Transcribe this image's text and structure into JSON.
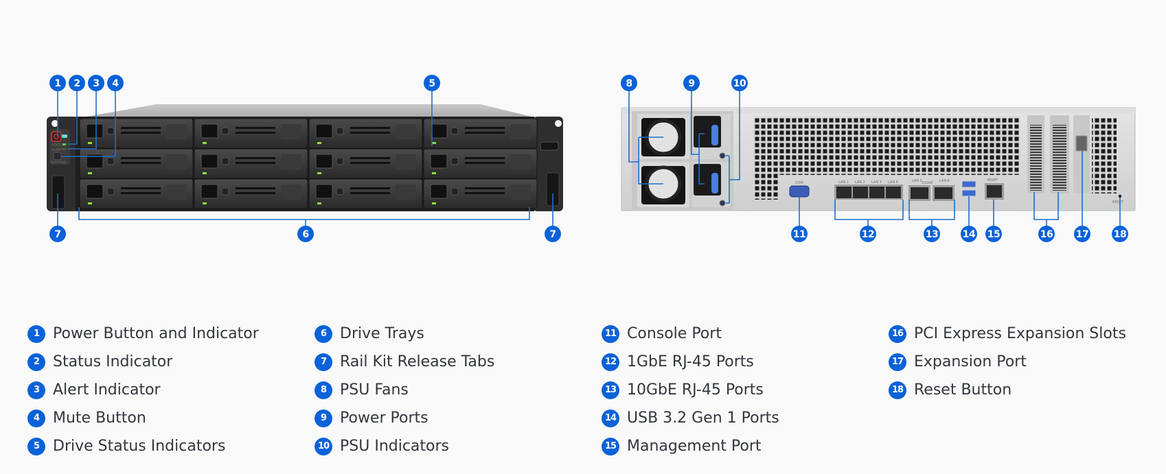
{
  "colors": {
    "badge": "#0a62d8",
    "leader_line": "#1f6fc9",
    "led_green": "#8fe03a",
    "background": "#f9f9f9"
  },
  "front_panel": {
    "panel_labels": {
      "status": "STATUS",
      "alert": "ALERT",
      "logo": "Synology"
    },
    "drive_bay_rows": 3,
    "drive_bay_columns": 4,
    "callouts": [
      {
        "number": "1"
      },
      {
        "number": "2"
      },
      {
        "number": "3"
      },
      {
        "number": "4"
      },
      {
        "number": "5"
      },
      {
        "number": "6"
      },
      {
        "number": "7"
      },
      {
        "number": "7"
      }
    ]
  },
  "rear_panel": {
    "port_labels": {
      "com": "COM",
      "lan1": "LAN 1",
      "lan2": "LAN 2",
      "lan3": "LAN 3",
      "lan4": "LAN 4",
      "lan5": "LAN 5",
      "lan6": "LAN 6",
      "tengbe": "10GbE",
      "mgmt": "MGMT",
      "reset": "RESET"
    },
    "callouts": [
      {
        "number": "8"
      },
      {
        "number": "9"
      },
      {
        "number": "10"
      },
      {
        "number": "11"
      },
      {
        "number": "12"
      },
      {
        "number": "13"
      },
      {
        "number": "14"
      },
      {
        "number": "15"
      },
      {
        "number": "16"
      },
      {
        "number": "17"
      },
      {
        "number": "18"
      }
    ]
  },
  "legend": {
    "columns": [
      [
        {
          "number": "1",
          "label": "Power Button and Indicator"
        },
        {
          "number": "2",
          "label": "Status Indicator"
        },
        {
          "number": "3",
          "label": "Alert Indicator"
        },
        {
          "number": "4",
          "label": "Mute Button"
        },
        {
          "number": "5",
          "label": "Drive Status Indicators"
        }
      ],
      [
        {
          "number": "6",
          "label": "Drive Trays"
        },
        {
          "number": "7",
          "label": "Rail Kit Release Tabs"
        },
        {
          "number": "8",
          "label": "PSU Fans"
        },
        {
          "number": "9",
          "label": "Power Ports"
        },
        {
          "number": "10",
          "label": "PSU Indicators"
        }
      ],
      [
        {
          "number": "11",
          "label": "Console Port"
        },
        {
          "number": "12",
          "label": "1GbE RJ-45 Ports"
        },
        {
          "number": "13",
          "label": "10GbE RJ-45 Ports"
        },
        {
          "number": "14",
          "label": "USB 3.2 Gen 1 Ports"
        },
        {
          "number": "15",
          "label": "Management Port"
        }
      ],
      [
        {
          "number": "16",
          "label": "PCI Express Expansion Slots"
        },
        {
          "number": "17",
          "label": "Expansion Port"
        },
        {
          "number": "18",
          "label": "Reset Button"
        }
      ]
    ]
  }
}
